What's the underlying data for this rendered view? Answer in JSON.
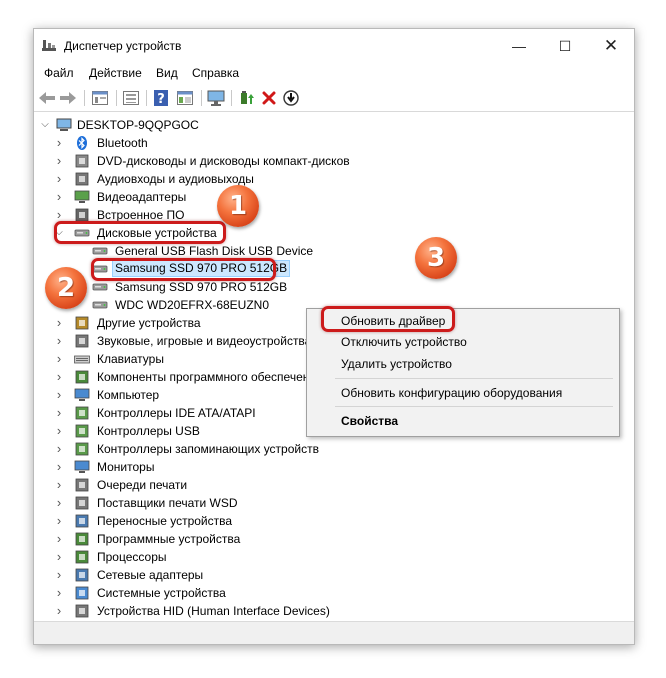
{
  "window": {
    "title": "Диспетчер устройств",
    "controls": {
      "minimize": "—",
      "maximize": "☐",
      "close": "✕"
    }
  },
  "menu": [
    "Файл",
    "Действие",
    "Вид",
    "Справка"
  ],
  "toolbar": {
    "icons": [
      "back-arrow-icon",
      "forward-arrow-icon",
      "properties-icon",
      "show-hide-icon",
      "help-icon",
      "list-view-icon",
      "monitor-icon",
      "update-driver-icon",
      "uninstall-device-icon",
      "scan-download-icon"
    ]
  },
  "tree": {
    "root": "DESKTOP-9QQPGOC",
    "items": [
      {
        "label": "Bluetooth",
        "icon": "bluetooth-icon"
      },
      {
        "label": "DVD-дисководы и дисководы компакт-дисков",
        "icon": "dvd-drive-icon"
      },
      {
        "label": "Аудиовходы и аудиовыходы",
        "icon": "audio-icon"
      },
      {
        "label": "Видеоадаптеры",
        "icon": "display-adapter-icon"
      },
      {
        "label": "Встроенное ПО",
        "icon": "firmware-icon"
      },
      {
        "label": "Дисковые устройства",
        "icon": "disk-drive-icon",
        "expanded": true
      },
      {
        "label": "General USB Flash Disk USB Device",
        "icon": "disk-drive-icon",
        "child": true
      },
      {
        "label": "Samsung SSD 970 PRO 512GB",
        "icon": "disk-drive-icon",
        "child": true,
        "selected": true
      },
      {
        "label": "Samsung SSD 970 PRO 512GB",
        "icon": "disk-drive-icon",
        "child": true
      },
      {
        "label": "WDC WD20EFRX-68EUZN0",
        "icon": "disk-drive-icon",
        "child": true
      },
      {
        "label": "Другие устройства",
        "icon": "other-devices-icon"
      },
      {
        "label": "Звуковые, игровые и видеоустройства",
        "icon": "sound-icon"
      },
      {
        "label": "Клавиатуры",
        "icon": "keyboard-icon"
      },
      {
        "label": "Компоненты программного обеспечения",
        "icon": "software-component-icon"
      },
      {
        "label": "Компьютер",
        "icon": "computer-icon"
      },
      {
        "label": "Контроллеры IDE ATA/ATAPI",
        "icon": "ide-controller-icon"
      },
      {
        "label": "Контроллеры USB",
        "icon": "usb-controller-icon"
      },
      {
        "label": "Контроллеры запоминающих устройств",
        "icon": "storage-controller-icon"
      },
      {
        "label": "Мониторы",
        "icon": "monitor-icon"
      },
      {
        "label": "Очереди печати",
        "icon": "printer-icon"
      },
      {
        "label": "Поставщики печати WSD",
        "icon": "printer-icon"
      },
      {
        "label": "Переносные устройства",
        "icon": "portable-device-icon"
      },
      {
        "label": "Программные устройства",
        "icon": "software-device-icon"
      },
      {
        "label": "Процессоры",
        "icon": "processor-icon"
      },
      {
        "label": "Сетевые адаптеры",
        "icon": "network-adapter-icon"
      },
      {
        "label": "Системные устройства",
        "icon": "system-device-icon"
      },
      {
        "label": "Устройства HID (Human Interface Devices)",
        "icon": "hid-icon"
      }
    ]
  },
  "context_menu": {
    "items": [
      "Обновить драйвер",
      "Отключить устройство",
      "Удалить устройство",
      "Обновить конфигурацию оборудования",
      "Свойства"
    ]
  },
  "badges": [
    "1",
    "2",
    "3"
  ],
  "colors": {
    "highlight": "#cc1b1b",
    "selection": "#cce8ff",
    "badge": "#f4733d"
  }
}
